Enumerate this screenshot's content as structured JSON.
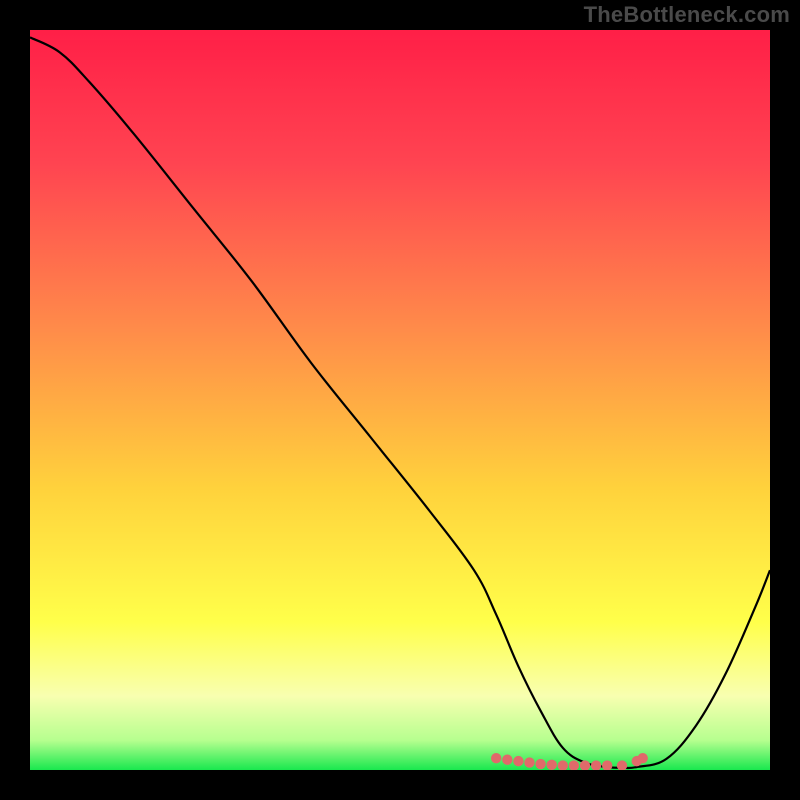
{
  "watermark": "TheBottleneck.com",
  "chart_data": {
    "type": "line",
    "title": "",
    "xlabel": "",
    "ylabel": "",
    "xlim": [
      0,
      100
    ],
    "ylim": [
      0,
      100
    ],
    "gradient_stops": [
      {
        "offset": 0,
        "color": "#ff1f47"
      },
      {
        "offset": 18,
        "color": "#ff4451"
      },
      {
        "offset": 40,
        "color": "#ff8a4a"
      },
      {
        "offset": 62,
        "color": "#ffd23c"
      },
      {
        "offset": 80,
        "color": "#ffff4a"
      },
      {
        "offset": 90,
        "color": "#f8ffb0"
      },
      {
        "offset": 96,
        "color": "#b6ff8f"
      },
      {
        "offset": 100,
        "color": "#19e84e"
      }
    ],
    "series": [
      {
        "name": "bottleneck-curve",
        "x": [
          0,
          4,
          8,
          14,
          22,
          30,
          38,
          46,
          54,
          60,
          63,
          66,
          69,
          72,
          75,
          78,
          80,
          82,
          86,
          90,
          94,
          98,
          100
        ],
        "values": [
          99,
          97,
          93,
          86,
          76,
          66,
          55,
          45,
          35,
          27,
          21,
          14,
          8,
          3,
          1,
          0.4,
          0.3,
          0.4,
          1.5,
          6,
          13,
          22,
          27
        ]
      }
    ],
    "markers": {
      "name": "optimal-range-dots",
      "color": "#e06a6a",
      "x": [
        63,
        64.5,
        66,
        67.5,
        69,
        70.5,
        72,
        73.5,
        75,
        76.5,
        78,
        80,
        82,
        82.8
      ],
      "values": [
        1.6,
        1.4,
        1.2,
        1.0,
        0.8,
        0.7,
        0.6,
        0.6,
        0.6,
        0.6,
        0.6,
        0.6,
        1.2,
        1.6
      ]
    }
  }
}
